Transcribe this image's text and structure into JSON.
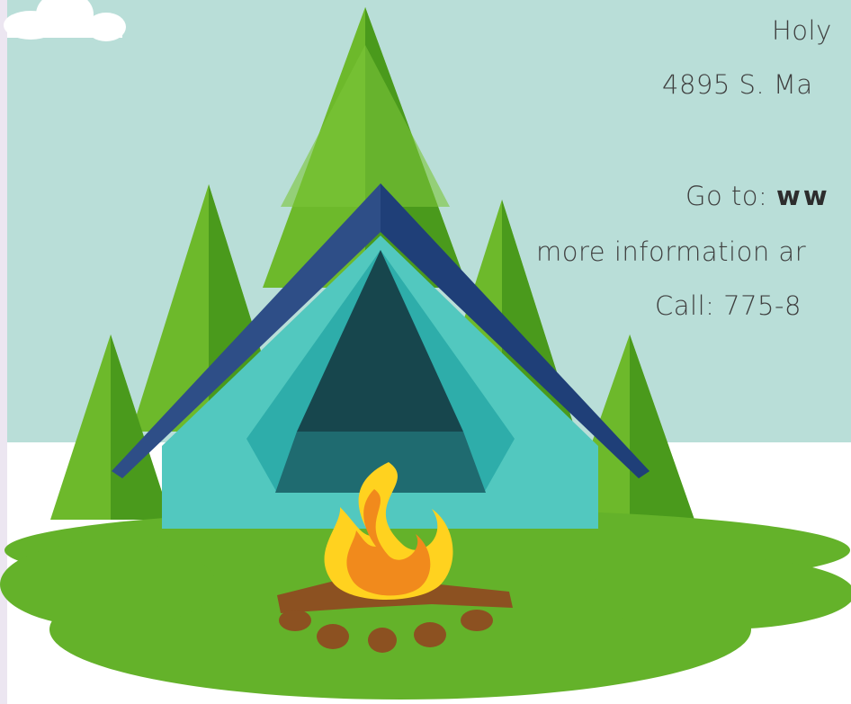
{
  "text": {
    "line1": "Holy",
    "line2": "4895 S. Ma",
    "line3_prefix": "Go to: ",
    "line3_link": "ww",
    "line4": "more information ar",
    "line5": "Call: 775-8"
  },
  "colors": {
    "sky": "#b9ded8",
    "ground": "#ffffff",
    "grass": "#64b22a",
    "tree_light": "#6db92b",
    "tree_dark": "#4a9a1c",
    "tent_outer": "#2e4e87",
    "tent_body": "#52c8bf",
    "tent_flap": "#2eadaa",
    "tent_inner_dark": "#17464d",
    "tent_inner_floor": "#1f6b70",
    "fire_outer": "#ffd21f",
    "fire_inner": "#f18a1c",
    "logs": "#8c5121",
    "text": "#3f3f3f"
  }
}
